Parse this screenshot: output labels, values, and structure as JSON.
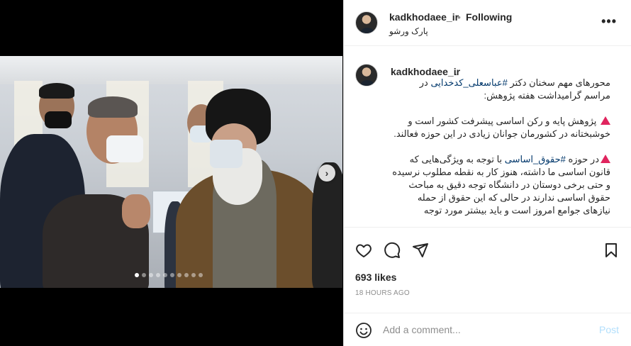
{
  "header": {
    "username": "kadkhodaee_ir",
    "separator": "•",
    "follow_status": "Following",
    "location": "پارک ورشو",
    "more_label": "•••"
  },
  "post": {
    "caption_user": "kadkhodaee_ir",
    "caption_dot": ".",
    "caption_line1": "محورهای مهم سخنان دکتر ",
    "caption_tag1": "#عباسعلی_کدخدایی",
    "caption_line1b": " در مراسم گرامیداشت هفته پژوهش:",
    "caption_para2": " پژوهش پایه و رکن اساسی پیشرفت کشور است و خوشبختانه در کشورمان جوانان زیادی در این حوزه فعالند.",
    "caption_para3a": "در حوزه ",
    "caption_tag2": "#حقوق_اساسی",
    "caption_para3b": " با توجه به ویژگی‌هایی که قانون اساسی ما داشته، هنوز کار به نقطه مطلوب نرسیده و حتی برخی دوستان در دانشگاه توجه دقیق به مباحث حقوق اساسی ندارند در حالی که این حقوق از حمله نیازهای جوامع امروز است و باید بیشتر مورد توجه",
    "likes": "693 likes",
    "timestamp": "18 HOURS AGO"
  },
  "carousel": {
    "next_label": "›",
    "total_slides": 10,
    "active_index": 0
  },
  "comment": {
    "placeholder": "Add a comment...",
    "post_label": "Post"
  },
  "icons": {
    "like": "heart-icon",
    "comment": "comment-icon",
    "share": "share-icon",
    "save": "bookmark-icon",
    "emoji": "emoji-icon"
  },
  "colors": {
    "hashtag": "#00376b",
    "alert_triangle": "#e0245e",
    "post_disabled": "#b2dffc"
  }
}
